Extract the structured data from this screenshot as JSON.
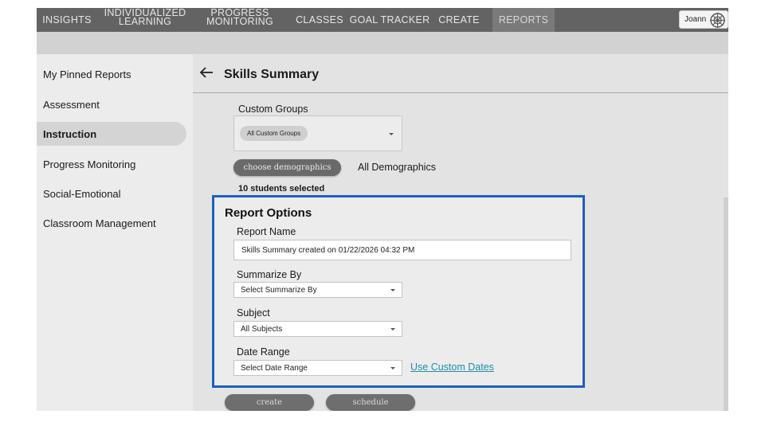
{
  "nav": {
    "items": [
      {
        "label": "INSIGHTS"
      },
      {
        "label": "INDIVIDUALIZED\nLEARNING"
      },
      {
        "label": "PROGRESS\nMONITORING"
      },
      {
        "label": "CLASSES"
      },
      {
        "label": "GOAL TRACKER"
      },
      {
        "label": "CREATE"
      },
      {
        "label": "REPORTS",
        "active": true
      }
    ],
    "user_name": "Joann"
  },
  "sidebar": {
    "items": [
      {
        "label": "My Pinned Reports"
      },
      {
        "label": "Assessment"
      },
      {
        "label": "Instruction",
        "active": true
      },
      {
        "label": "Progress Monitoring"
      },
      {
        "label": "Social-Emotional"
      },
      {
        "label": "Classroom Management"
      }
    ]
  },
  "main": {
    "title": "Skills Summary",
    "custom_groups": {
      "label": "Custom Groups",
      "chip": "All Custom Groups"
    },
    "demographics": {
      "button": "choose demographics",
      "value": "All Demographics"
    },
    "students_selected": "10 students selected"
  },
  "report_options": {
    "title": "Report Options",
    "report_name": {
      "label": "Report Name",
      "value": "Skills Summary created on 01/22/2026 04:32 PM"
    },
    "summarize_by": {
      "label": "Summarize By",
      "value": "Select Summarize By"
    },
    "subject": {
      "label": "Subject",
      "value": "All Subjects"
    },
    "date_range": {
      "label": "Date Range",
      "value": "Select Date Range",
      "custom_link": "Use Custom Dates"
    }
  },
  "actions": {
    "create": "create",
    "schedule": "schedule"
  },
  "colors": {
    "panel_border": "#1d5fc4",
    "link": "#1e8fa8",
    "nav_bg": "#636363"
  }
}
